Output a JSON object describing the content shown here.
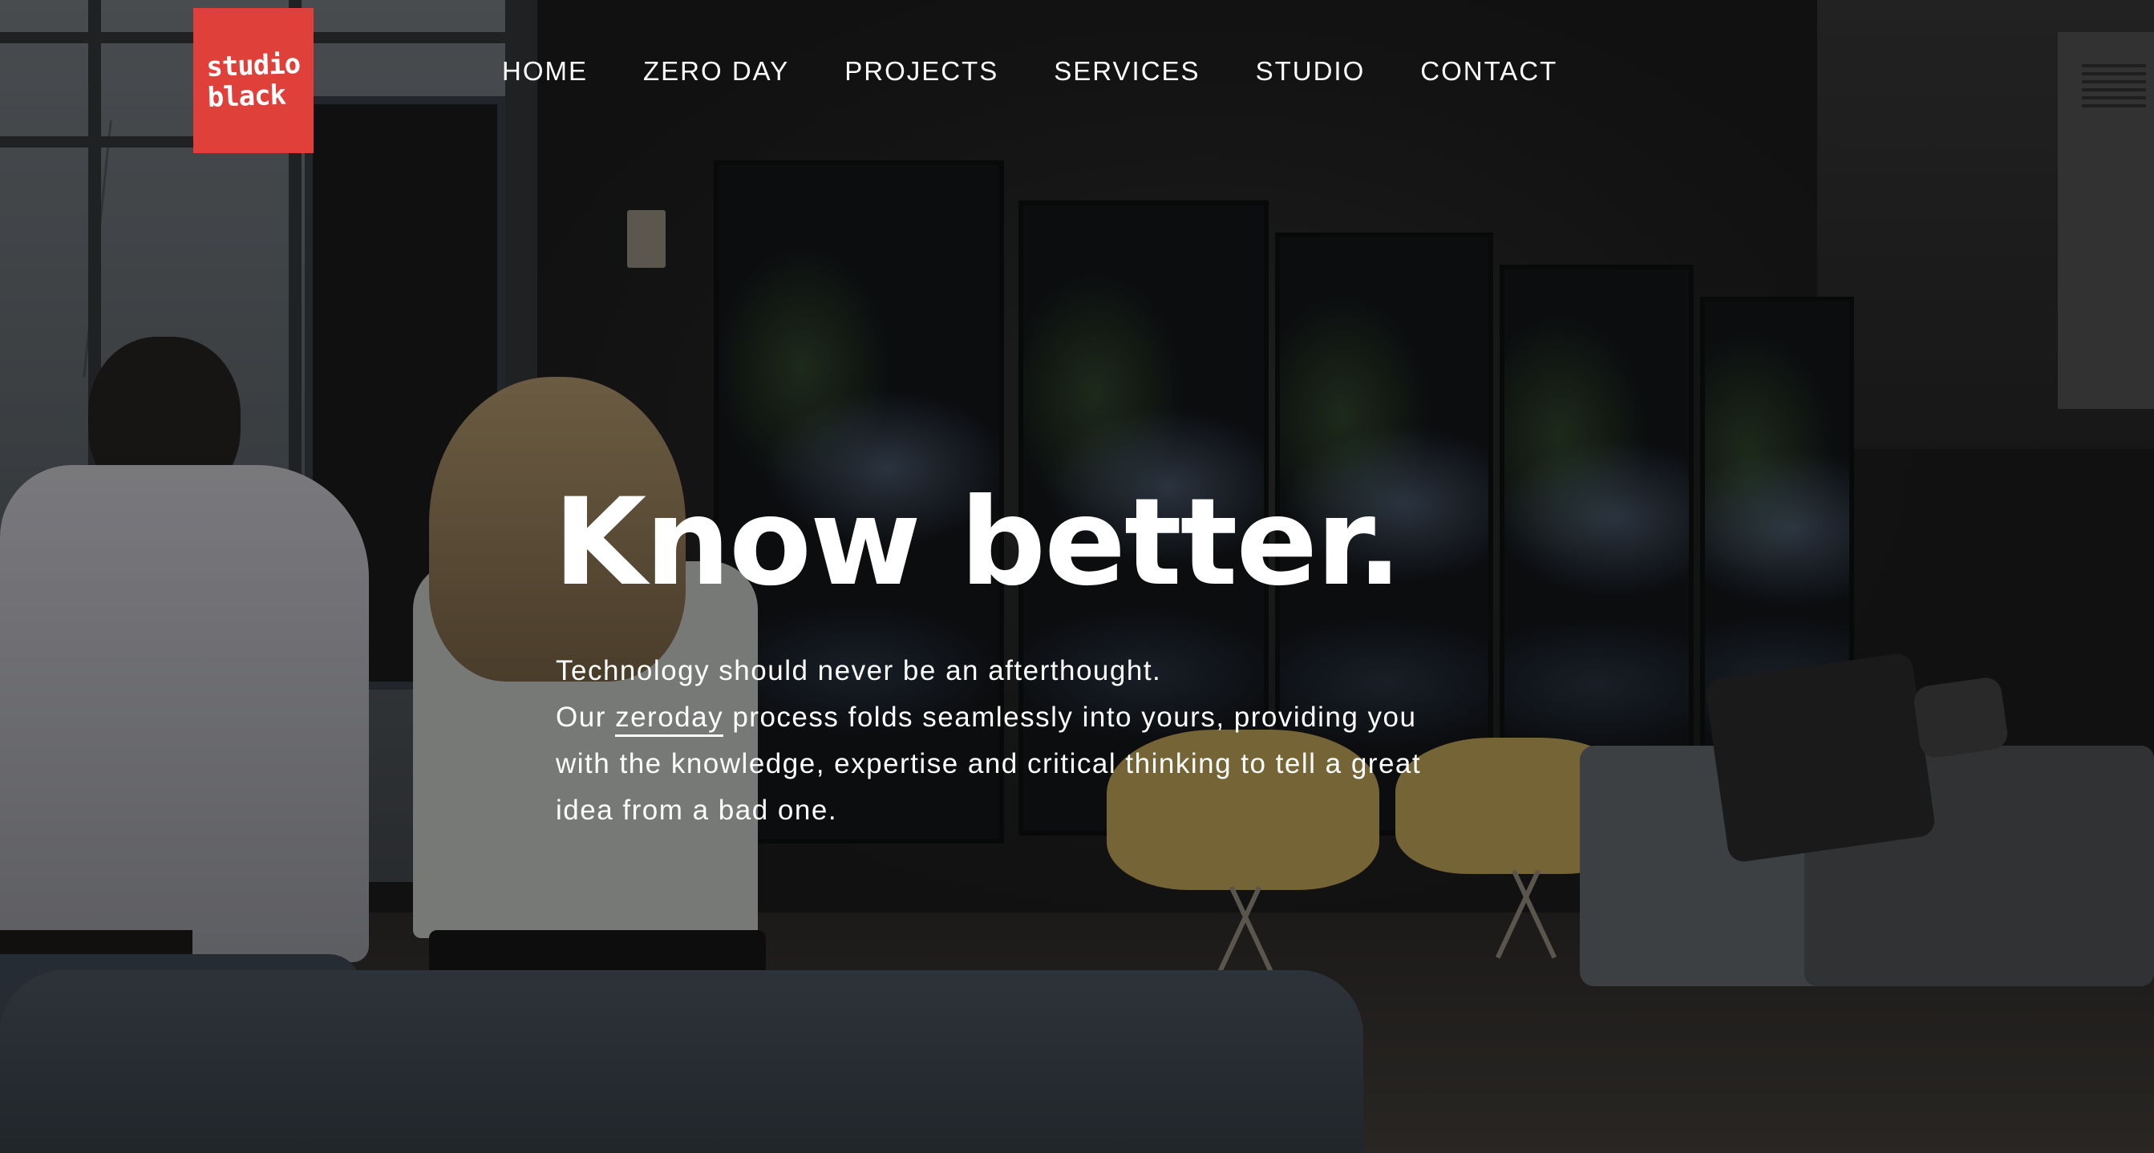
{
  "logo": {
    "line1": "studio",
    "line2": "black"
  },
  "nav": {
    "items": [
      {
        "label": "HOME"
      },
      {
        "label": "ZERO DAY"
      },
      {
        "label": "PROJECTS"
      },
      {
        "label": "SERVICES"
      },
      {
        "label": "STUDIO"
      },
      {
        "label": "CONTACT"
      }
    ]
  },
  "hero": {
    "title": "Know better.",
    "line1": "Technology should never be an afterthought.",
    "line2_prefix": "Our ",
    "line2_link": "zeroday",
    "line2_suffix": " process folds seamlessly into yours, providing you",
    "line3": "with the knowledge, expertise and critical thinking to tell a great",
    "line4": "idea from a bad one."
  },
  "colors": {
    "logo_background": "#e0403a",
    "text": "#ffffff",
    "overlay": "#141414"
  }
}
